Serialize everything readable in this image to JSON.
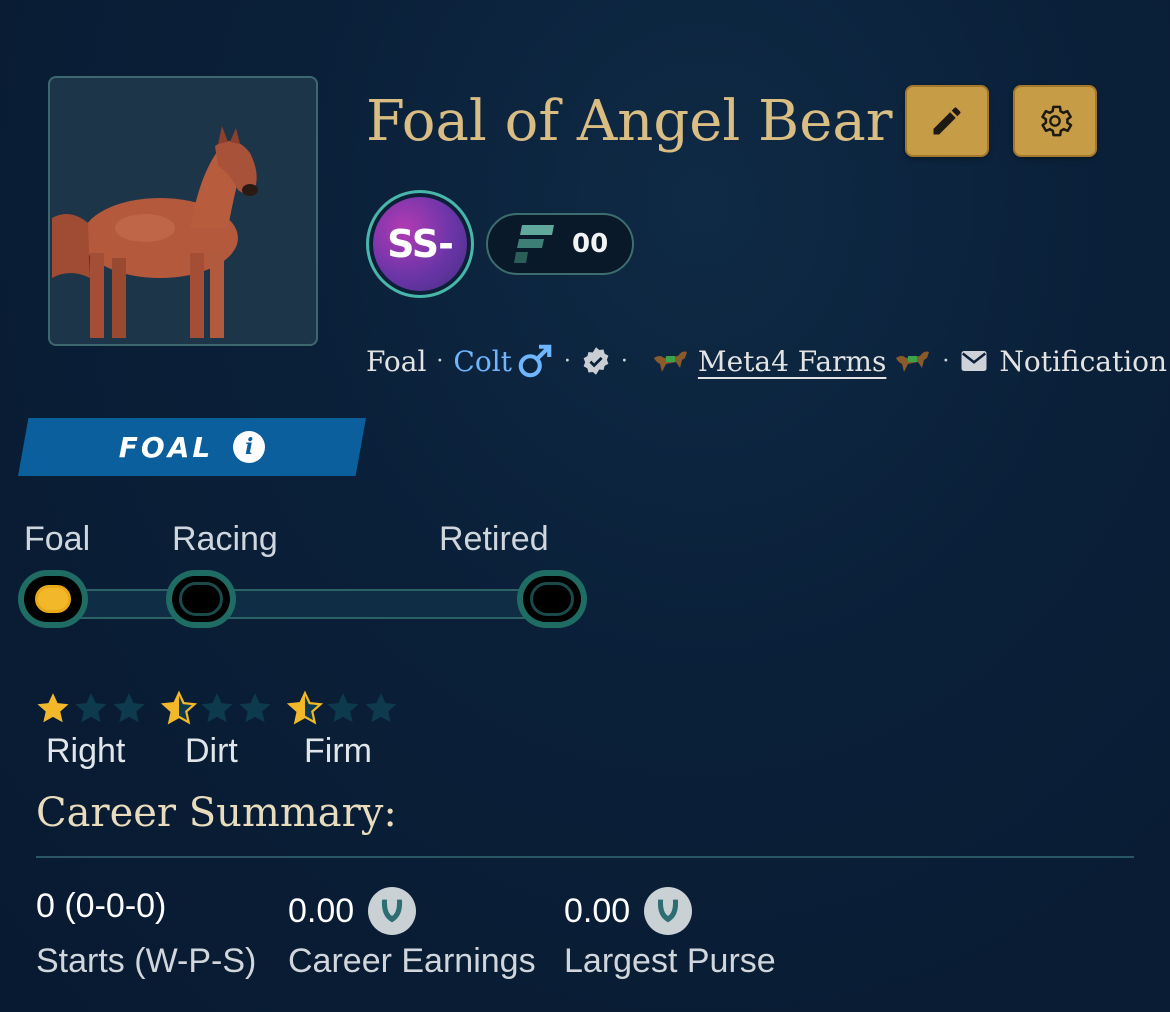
{
  "horse": {
    "name": "Foal of Angel Bear",
    "grade": "SS-",
    "f_count": "00",
    "age_stage": "Foal",
    "gender": "Colt",
    "farm": "Meta4 Farms",
    "notifications_label": "Notification"
  },
  "stage_banner": {
    "label": "FOAL"
  },
  "lifecycle": {
    "stages": [
      "Foal",
      "Racing",
      "Retired"
    ],
    "current": "Foal"
  },
  "preferences": [
    {
      "label": "Right",
      "rating": 1,
      "max": 3
    },
    {
      "label": "Dirt",
      "rating": 0.5,
      "max": 3
    },
    {
      "label": "Firm",
      "rating": 0.5,
      "max": 3
    }
  ],
  "career": {
    "title": "Career Summary:",
    "starts_value": "0 (0-0-0)",
    "starts_label": "Starts (W-P-S)",
    "earnings_value": "0.00",
    "earnings_label": "Career Earnings",
    "largest_value": "0.00",
    "largest_label": "Largest Purse"
  },
  "colors": {
    "accent_gold": "#c79c47",
    "title_gold": "#d9bd83",
    "banner_blue": "#0b5f9c",
    "star_gold": "#f2b82a",
    "link_blue": "#6fb6ff"
  }
}
